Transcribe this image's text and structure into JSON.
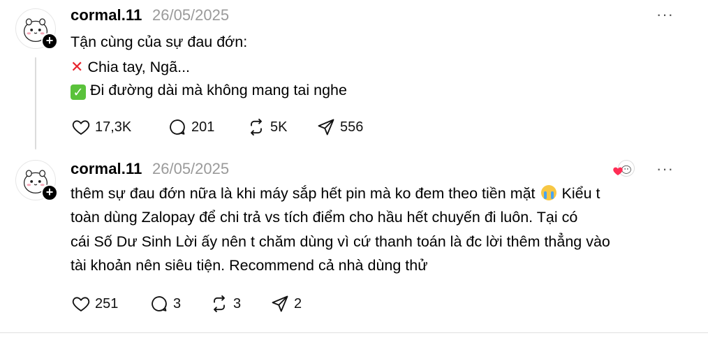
{
  "posts": [
    {
      "username": "cormal.11",
      "date": "26/05/2025",
      "follow_icon": "plus-icon",
      "more_icon": "more-horizontal-icon",
      "lines": [
        {
          "prefix_icon": "",
          "text": "Tận cùng của sự đau đớn:"
        },
        {
          "prefix_icon": "cross-mark-emoji",
          "text": "Chia tay, Ngã..."
        },
        {
          "prefix_icon": "check-mark-emoji",
          "text": "Đi đường dài mà không mang tai nghe"
        }
      ],
      "actions": {
        "likes": "17,3K",
        "replies": "201",
        "reposts": "5K",
        "shares": "556"
      }
    },
    {
      "username": "cormal.11",
      "date": "26/05/2025",
      "liked_by_author_icon": "heart-icon",
      "more_icon": "more-horizontal-icon",
      "lines": [
        {
          "text_before": "thêm sự đau đớn nữa là khi máy sắp hết pin mà ko đem theo tiền mặt",
          "emoji": "loudly-crying-face-emoji",
          "text_after": "Kiểu t"
        },
        {
          "text": "toàn dùng Zalopay để chi trả vs tích điểm cho hầu hết chuyến đi luôn. Tại có"
        },
        {
          "text": "cái Số Dư Sinh Lời ấy nên t chăm dùng vì cứ thanh toán là đc lời thêm thẳng vào"
        },
        {
          "text": "tài khoản nên siêu tiện. Recommend cả nhà dùng thử"
        }
      ],
      "actions": {
        "likes": "251",
        "replies": "3",
        "reposts": "3",
        "shares": "2"
      }
    }
  ],
  "more_label": "···",
  "colors": {
    "heart": "#ff2d55",
    "check": "#5ac23b",
    "cross": "#e8222c",
    "date": "#9a9a9a"
  }
}
